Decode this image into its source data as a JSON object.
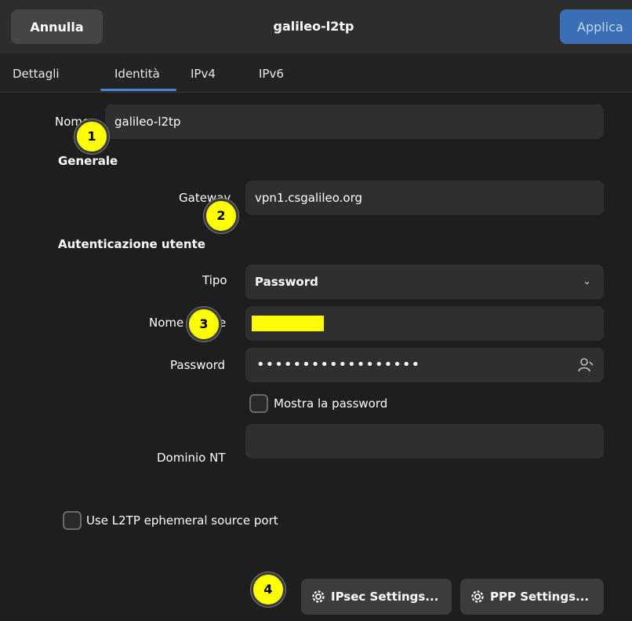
{
  "header": {
    "cancel_label": "Annulla",
    "title": "galileo-l2tp",
    "apply_label": "Applica"
  },
  "tabs": [
    {
      "label": "Dettagli"
    },
    {
      "label": "Identità"
    },
    {
      "label": "IPv4"
    },
    {
      "label": "IPv6"
    }
  ],
  "identity": {
    "name_label": "Nome",
    "name_value": "galileo-l2tp"
  },
  "general": {
    "section_title": "Generale",
    "gateway_label": "Gateway",
    "gateway_value": "vpn1.csgalileo.org"
  },
  "auth": {
    "section_title": "Autenticazione utente",
    "type_label": "Tipo",
    "type_value": "Password",
    "username_label": "Nome utente",
    "password_label": "Password",
    "password_dots": "••••••••••••••••••",
    "show_password_label": "Mostra la password",
    "nt_domain_label": "Dominio NT",
    "nt_domain_value": ""
  },
  "ephemeral_label": "Use L2TP ephemeral source port",
  "buttons": {
    "ipsec_label": "IPsec Settings...",
    "ppp_label": "PPP Settings..."
  },
  "markers": [
    "1",
    "2",
    "3",
    "4"
  ],
  "colors": {
    "accent": "#4a86d8",
    "apply": "#3a6fb5",
    "marker": "#ffff00",
    "redaction": "#ffff00"
  }
}
